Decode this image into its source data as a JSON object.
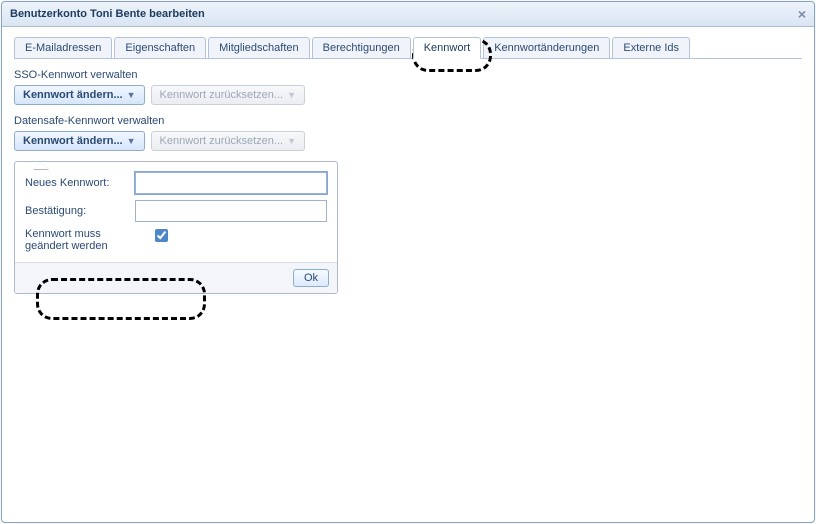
{
  "title": "Benutzerkonto Toni Bente bearbeiten",
  "tabs": [
    {
      "label": "E-Mailadressen"
    },
    {
      "label": "Eigenschaften"
    },
    {
      "label": "Mitgliedschaften"
    },
    {
      "label": "Berechtigungen"
    },
    {
      "label": "Kennwort",
      "active": true
    },
    {
      "label": "Kennwortänderungen"
    },
    {
      "label": "Externe Ids"
    }
  ],
  "sso": {
    "section_label": "SSO-Kennwort verwalten",
    "change_btn": "Kennwort ändern...",
    "reset_btn": "Kennwort zurücksetzen..."
  },
  "safe": {
    "section_label": "Datensafe-Kennwort verwalten",
    "change_btn": "Kennwort ändern...",
    "reset_btn": "Kennwort zurücksetzen..."
  },
  "form": {
    "new_pw_label": "Neues Kennwort:",
    "confirm_label": "Bestätigung:",
    "new_pw_value": "",
    "confirm_value": "",
    "must_change_label": "Kennwort muss geändert werden",
    "must_change_checked": true,
    "ok_label": "Ok"
  }
}
